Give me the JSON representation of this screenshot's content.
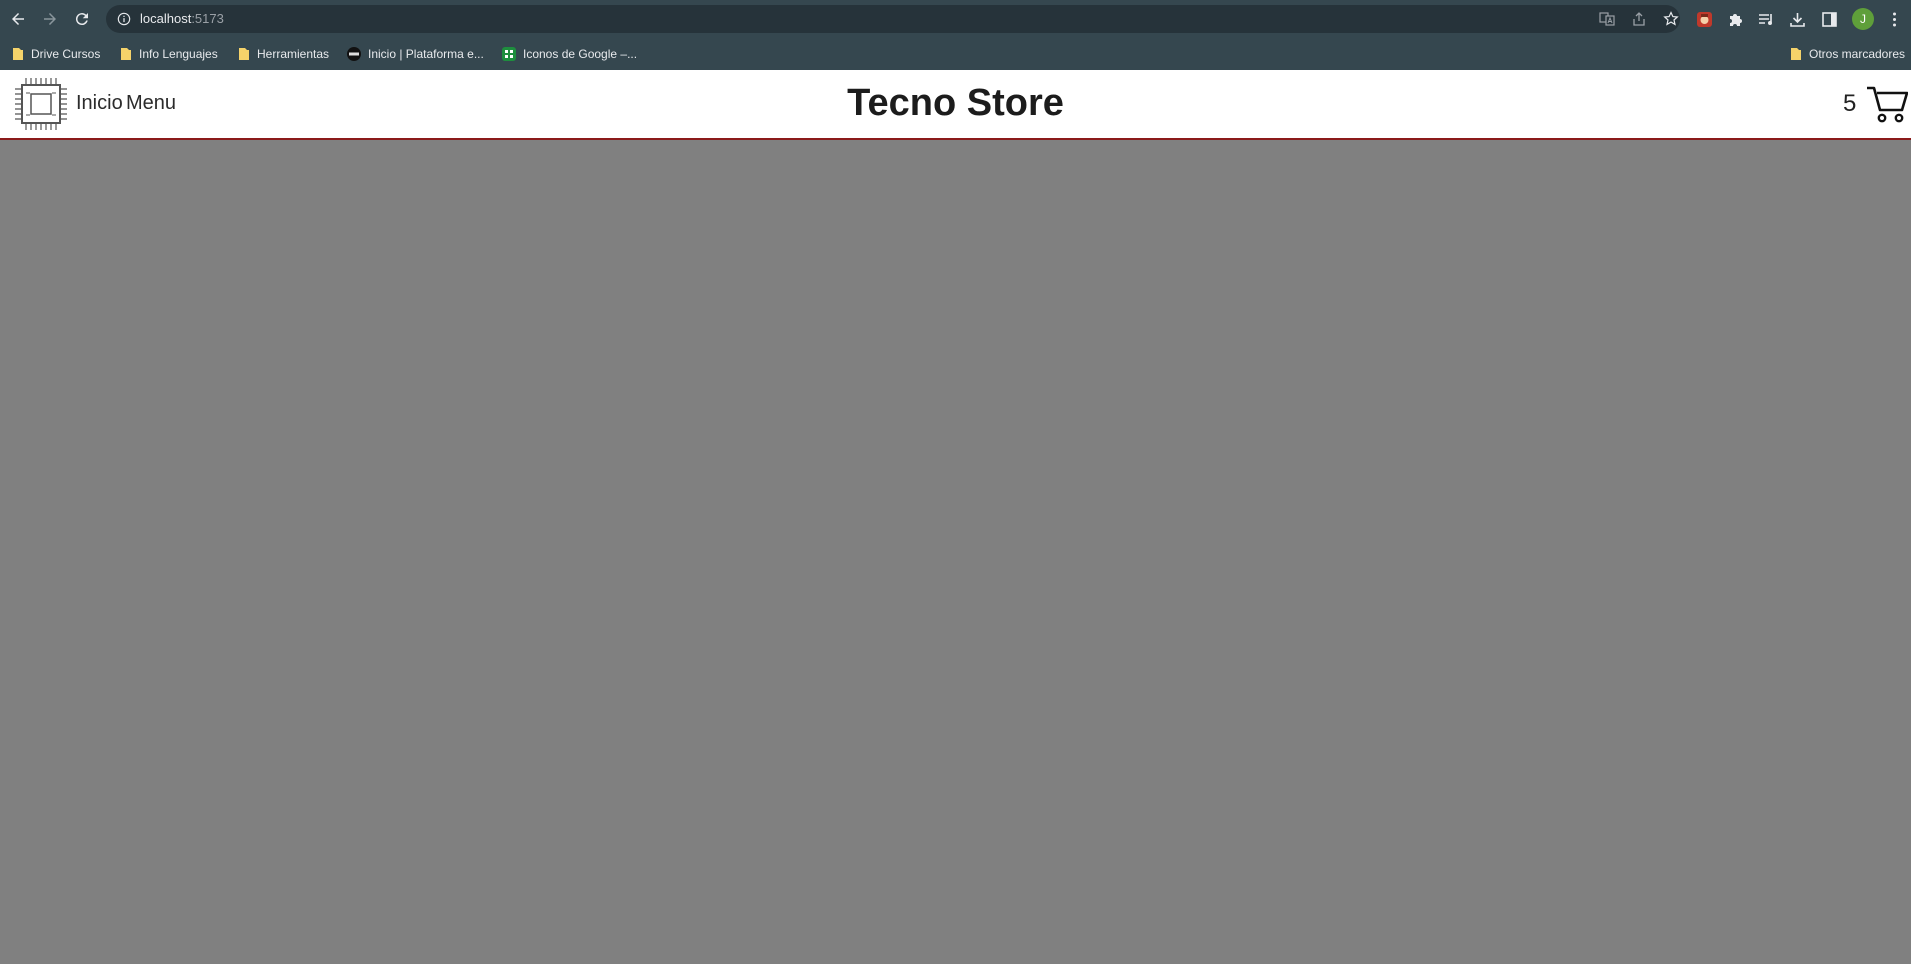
{
  "browser": {
    "url_host": "localhost",
    "url_port": ":5173",
    "profile_initial": "J",
    "toolbar_icons": [
      "back-icon",
      "forward-icon",
      "reload-icon",
      "info-icon",
      "translate-icon",
      "share-icon",
      "star-icon",
      "extension-icon",
      "puzzle-icon",
      "media-icon",
      "download-icon",
      "side-panel-icon",
      "more-icon"
    ]
  },
  "bookmarks": {
    "items": [
      {
        "label": "Drive Cursos",
        "icon": "folder-icon"
      },
      {
        "label": "Info Lenguajes",
        "icon": "folder-icon"
      },
      {
        "label": "Herramientas",
        "icon": "folder-icon"
      },
      {
        "label": "Inicio | Plataforma e...",
        "icon": "site-favicon"
      },
      {
        "label": "Iconos de Google –...",
        "icon": "google-fonts-favicon"
      }
    ],
    "other": "Otros marcadores"
  },
  "header": {
    "logo_icon": "chip-icon",
    "nav": [
      "Inicio",
      "Menu"
    ],
    "title": "Tecno Store",
    "cart_count": "5",
    "cart_icon": "cart-icon"
  },
  "colors": {
    "chrome": "#35474f",
    "omnibox": "#26333a",
    "header_border": "#8b1a1a",
    "main_background": "#808080"
  }
}
